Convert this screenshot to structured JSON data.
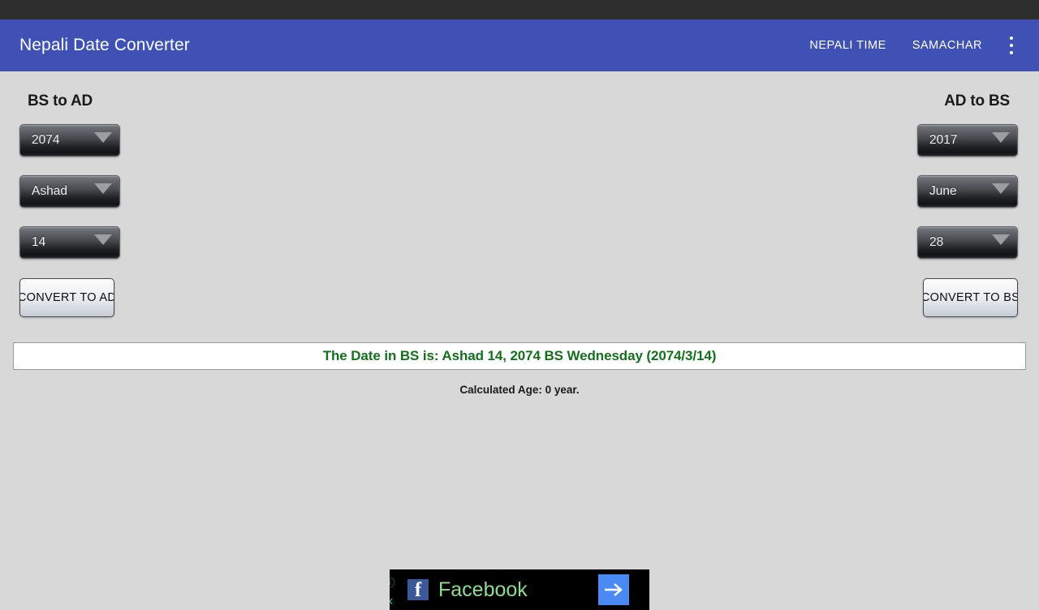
{
  "status_bar": {
    "present": true
  },
  "app_bar": {
    "title": "Nepali Date Converter",
    "background_color": "#3f51b5",
    "actions": [
      {
        "label": "NEPALI TIME",
        "name": "nepali-time"
      },
      {
        "label": "SAMACHAR",
        "name": "samachar"
      }
    ],
    "overflow_icon": "more-vertical-icon"
  },
  "panels": {
    "left": {
      "heading": "BS to AD",
      "spinners": [
        {
          "name": "bs-year-spinner",
          "value": "2074"
        },
        {
          "name": "bs-month-spinner",
          "value": "Ashad"
        },
        {
          "name": "bs-day-spinner",
          "value": "14"
        }
      ],
      "button": {
        "label": "CONVERT TO AD",
        "name": "convert-to-ad-button"
      }
    },
    "right": {
      "heading": "AD to BS",
      "spinners": [
        {
          "name": "ad-year-spinner",
          "value": "2017"
        },
        {
          "name": "ad-month-spinner",
          "value": "June"
        },
        {
          "name": "ad-day-spinner",
          "value": "28"
        }
      ],
      "button": {
        "label": "CONVERT TO BS",
        "name": "convert-to-bs-button"
      }
    }
  },
  "result": {
    "text": "The Date in BS is: Ashad 14, 2074 BS Wednesday (2074/3/14)",
    "color": "#13701c",
    "age_text": "Calculated Age: 0 year."
  },
  "ad": {
    "title": "Facebook",
    "logo_letter": "f",
    "logo_color": "#3b5998",
    "title_color": "#8fdc8f",
    "cta_color": "#4a8af4",
    "info_icon": "info-circle-icon",
    "close_icon": "close-icon",
    "info_glyph": "ⓘ",
    "close_glyph": "✕",
    "cta_icon": "arrow-right-icon"
  }
}
